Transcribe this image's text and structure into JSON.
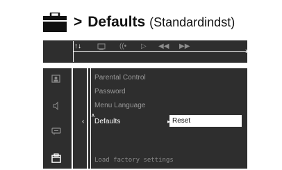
{
  "heading": {
    "arrow": ">",
    "title": "Defaults",
    "subtitle": "(Standardindst)"
  },
  "top_tabs": [
    "setup-icon",
    "screen-icon",
    "audio-icon",
    "play-icon",
    "rewind-icon",
    "forward-icon"
  ],
  "sidebar_icons": [
    "picture-icon",
    "speaker-icon",
    "subtitle-icon",
    "preferences-icon"
  ],
  "menu": {
    "items": [
      "Parental Control",
      "Password",
      "Menu Language",
      "Defaults"
    ],
    "current": "Defaults",
    "option": "Reset"
  },
  "status_text": "Load factory settings",
  "colors": {
    "osd_background": "#2e2e2e",
    "highlight": "#ffffff"
  }
}
